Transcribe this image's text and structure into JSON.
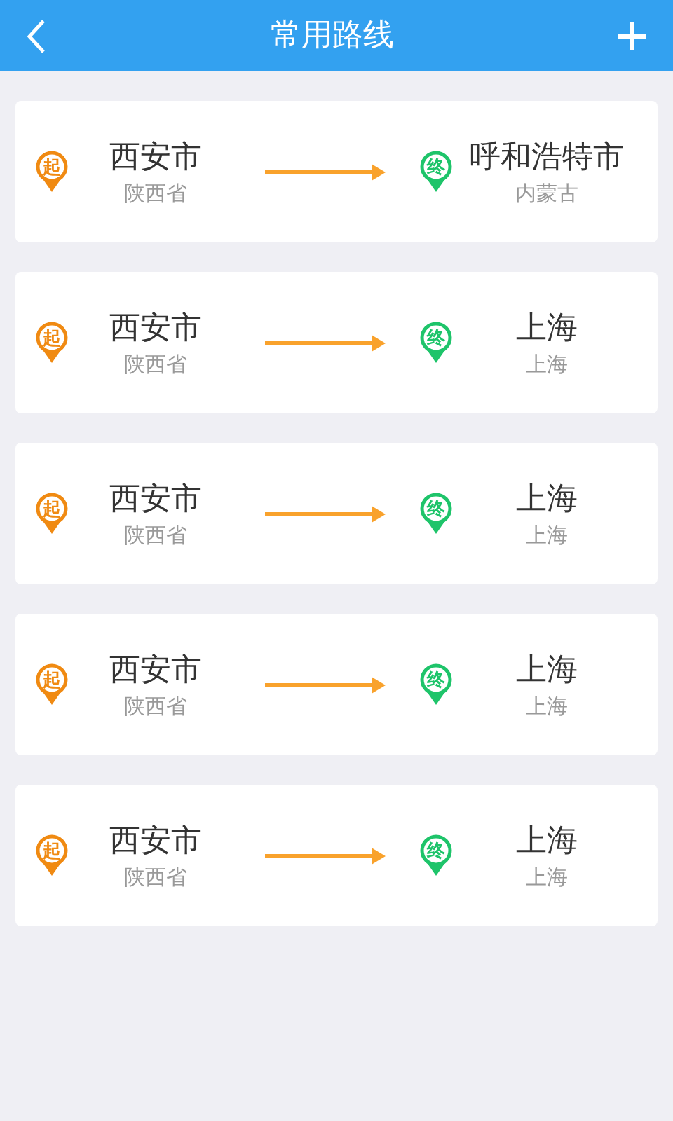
{
  "header": {
    "title": "常用路线"
  },
  "routes": [
    {
      "from": {
        "marker": "起",
        "city": "西安市",
        "province": "陕西省"
      },
      "to": {
        "marker": "终",
        "city": "呼和浩特市",
        "province": "内蒙古"
      }
    },
    {
      "from": {
        "marker": "起",
        "city": "西安市",
        "province": "陕西省"
      },
      "to": {
        "marker": "终",
        "city": "上海",
        "province": "上海"
      }
    },
    {
      "from": {
        "marker": "起",
        "city": "西安市",
        "province": "陕西省"
      },
      "to": {
        "marker": "终",
        "city": "上海",
        "province": "上海"
      }
    },
    {
      "from": {
        "marker": "起",
        "city": "西安市",
        "province": "陕西省"
      },
      "to": {
        "marker": "终",
        "city": "上海",
        "province": "上海"
      }
    },
    {
      "from": {
        "marker": "起",
        "city": "西安市",
        "province": "陕西省"
      },
      "to": {
        "marker": "终",
        "city": "上海",
        "province": "上海"
      }
    }
  ]
}
